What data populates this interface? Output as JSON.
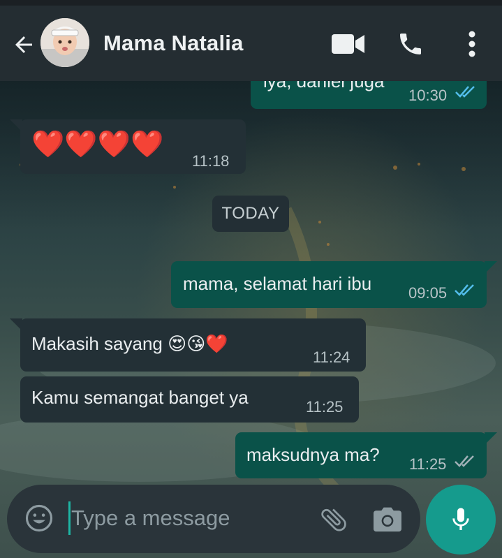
{
  "header": {
    "contact_name": "Mama Natalia",
    "icons": [
      "back-arrow-icon",
      "video-call-icon",
      "phone-call-icon",
      "more-vertical-icon"
    ]
  },
  "messages": [
    {
      "direction": "out",
      "text": "iya, daniel juga",
      "time": "10:30",
      "status": "read"
    },
    {
      "direction": "in",
      "text": "❤️❤️❤️❤️",
      "time": "11:18"
    },
    {
      "direction": "out",
      "text": "mama, selamat hari ibu",
      "time": "09:05",
      "status": "read"
    },
    {
      "direction": "in",
      "text": "Makasih sayang 😍😘❤️",
      "time": "11:24"
    },
    {
      "direction": "in",
      "text": "Kamu semangat banget ya",
      "time": "11:25"
    },
    {
      "direction": "out",
      "text": "maksudnya ma?",
      "time": "11:25",
      "status": "delivered"
    }
  ],
  "day_separator": "TODAY",
  "composer": {
    "placeholder": "Type a message",
    "icons": [
      "emoji-icon",
      "attach-icon",
      "camera-icon",
      "microphone-icon"
    ]
  },
  "colors": {
    "header_bg": "#242d32",
    "outgoing_bubble": "#0a5249",
    "incoming_bubble": "#233036",
    "read_tick": "#53bdeb",
    "mic_button": "#159b8d"
  }
}
